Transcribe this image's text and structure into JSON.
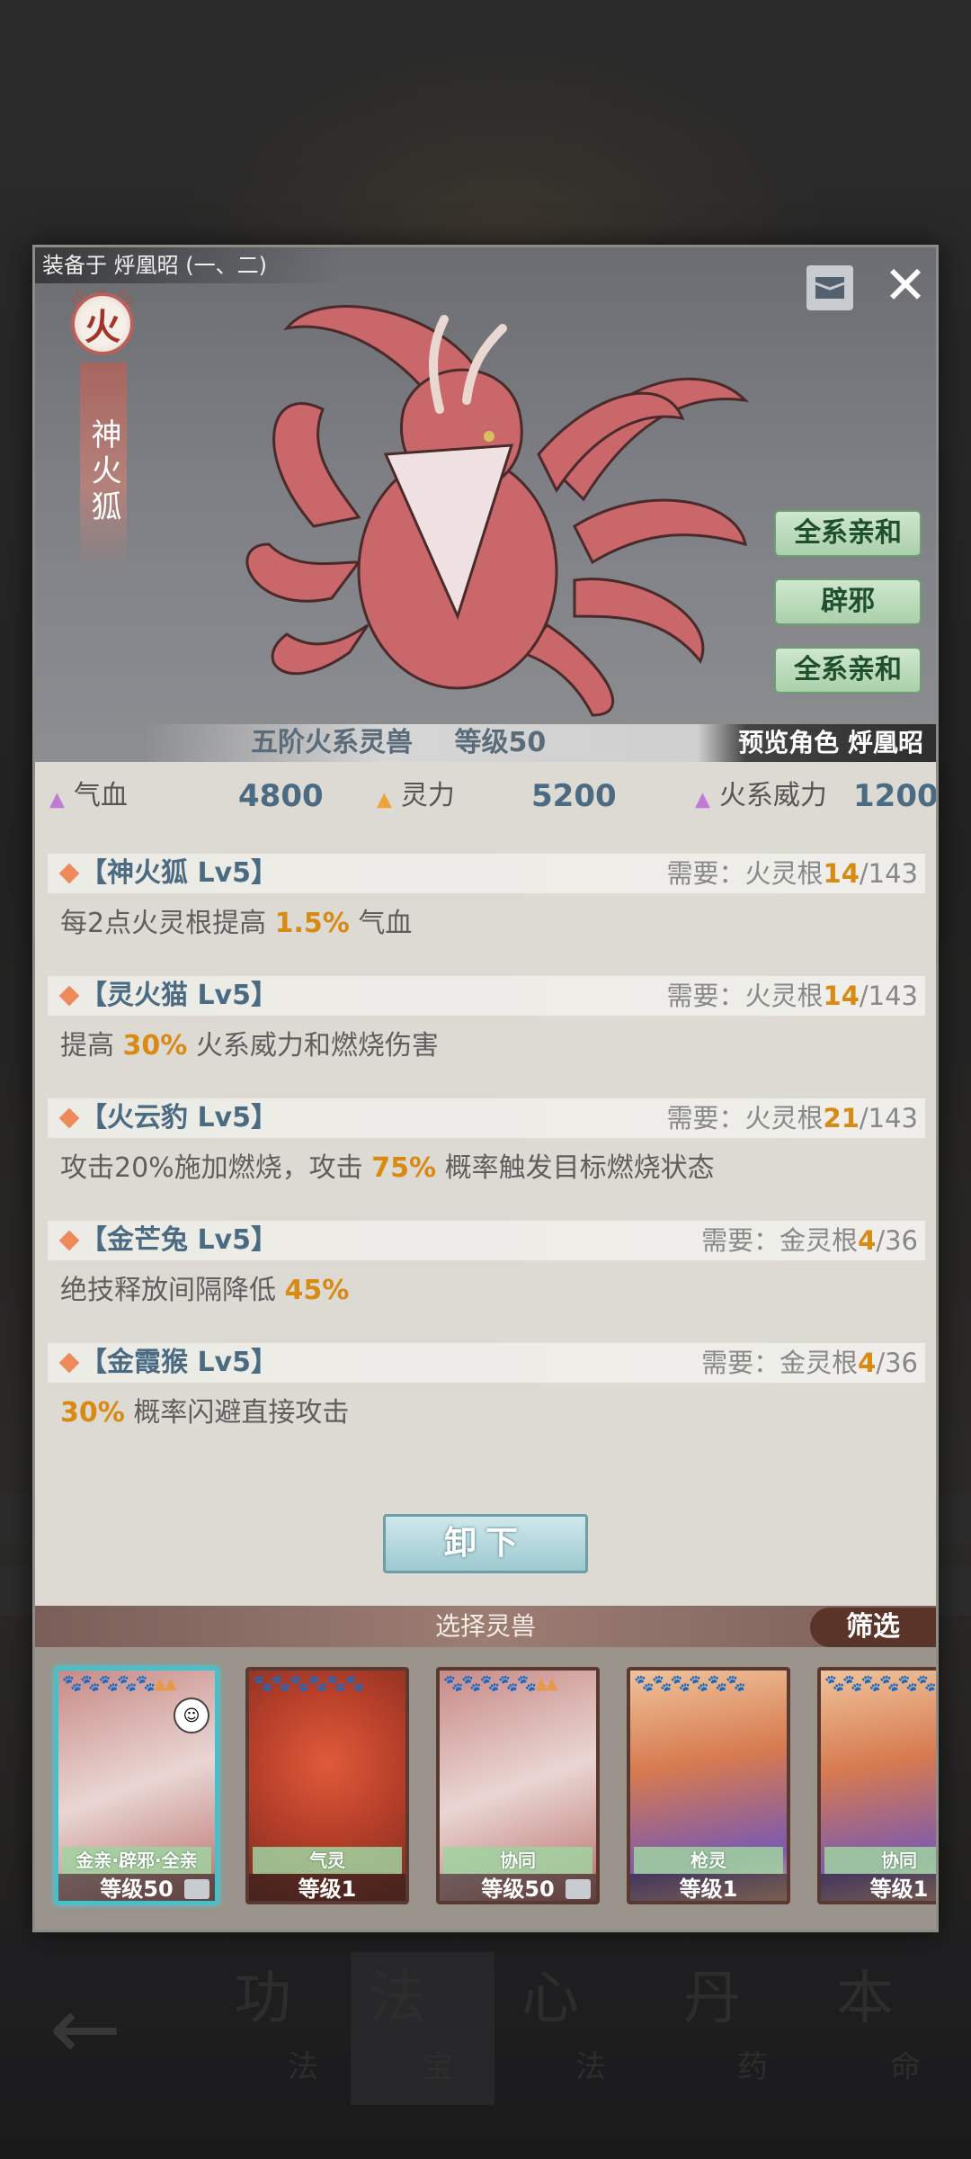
{
  "modal": {
    "equipped_on": "装备于 烀凰昭 (一、二)",
    "element": "火",
    "beast_name": "神火狐",
    "traits": [
      "全系亲和",
      "辟邪",
      "全系亲和"
    ],
    "info": {
      "rank": "五阶火系灵兽",
      "level_text": "等级50",
      "preview": "预览角色 烀凰昭"
    },
    "stats": [
      {
        "label": "气血",
        "value": "4800",
        "color": "#c07ad6"
      },
      {
        "label": "灵力",
        "value": "5200",
        "color": "#f0a33a"
      },
      {
        "label": "火系威力",
        "value": "1200",
        "color": "#c07ad6"
      }
    ],
    "skills": [
      {
        "title": "【神火狐 Lv5】",
        "req_prefix": "需要：火灵根",
        "req_cur": "14",
        "req_max": "/143",
        "desc_pre": "每2点火灵根提高 ",
        "desc_hl": "1.5%",
        "desc_post": " 气血"
      },
      {
        "title": "【灵火猫 Lv5】",
        "req_prefix": "需要：火灵根",
        "req_cur": "14",
        "req_max": "/143",
        "desc_pre": "提高 ",
        "desc_hl": "30%",
        "desc_post": " 火系威力和燃烧伤害"
      },
      {
        "title": "【火云豹 Lv5】",
        "req_prefix": "需要：火灵根",
        "req_cur": "21",
        "req_max": "/143",
        "desc_pre": "攻击20%施加燃烧，攻击 ",
        "desc_hl": "75%",
        "desc_post": " 概率触发目标燃烧状态"
      },
      {
        "title": "【金芒兔 Lv5】",
        "req_prefix": "需要：金灵根",
        "req_cur": "4",
        "req_max": "/36",
        "desc_pre": "绝技释放间隔降低 ",
        "desc_hl": "45%",
        "desc_post": ""
      },
      {
        "title": "【金霞猴 Lv5】",
        "req_prefix": "需要：金灵根",
        "req_cur": "4",
        "req_max": "/36",
        "desc_pre": "",
        "desc_hl": "30%",
        "desc_post": " 概率闪避直接攻击"
      }
    ],
    "unload_label": "卸下",
    "select_title": "选择灵兽",
    "filter_label": "筛选",
    "cards": [
      {
        "tag": "金亲·辟邪·全亲",
        "level": "等级50",
        "stars": "🐾🐾🐾🐾🐾▲▲",
        "selected": true
      },
      {
        "tag": "气灵",
        "level": "等级1",
        "stars": "🐾🐾🐾🐾🐾🐾",
        "selected": false
      },
      {
        "tag": "协同",
        "level": "等级50",
        "stars": "🐾🐾🐾🐾🐾▲▲",
        "selected": false
      },
      {
        "tag": "枪灵",
        "level": "等级1",
        "stars": "🐾🐾🐾🐾🐾🐾",
        "selected": false
      },
      {
        "tag": "协同",
        "level": "等级1",
        "stars": "🐾🐾🐾🐾🐾🐾",
        "selected": false
      }
    ]
  },
  "nav": {
    "items": [
      {
        "big": "功",
        "small": "法"
      },
      {
        "big": "法",
        "small": "宝"
      },
      {
        "big": "心",
        "small": "法"
      },
      {
        "big": "丹",
        "small": "药"
      },
      {
        "big": "本",
        "small": "命"
      }
    ]
  }
}
